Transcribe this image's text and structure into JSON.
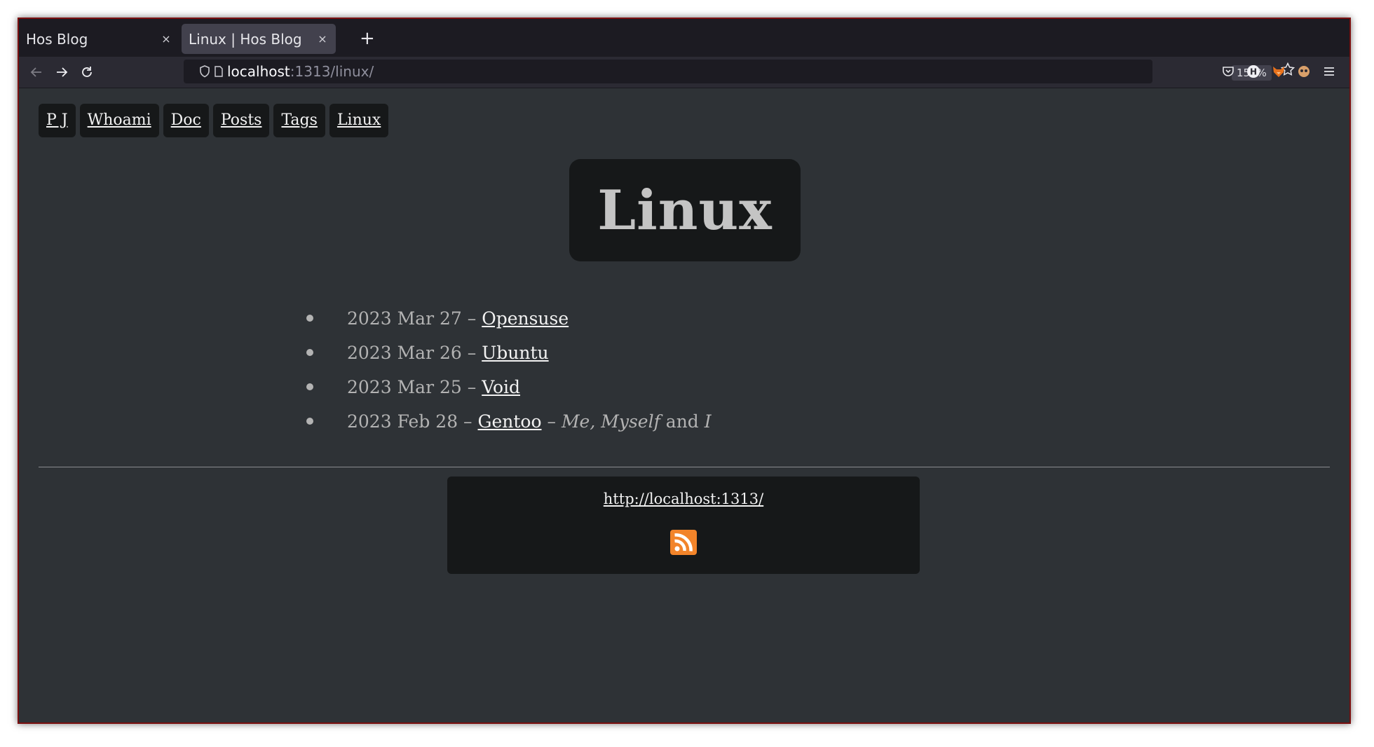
{
  "browser": {
    "tabs": [
      {
        "title": "Hos Blog",
        "active": false
      },
      {
        "title": "Linux | Hos Blog",
        "active": true
      }
    ],
    "new_tab_label": "+",
    "close_label": "×",
    "url": {
      "host": "localhost",
      "rest": ":1313/linux/"
    },
    "zoom": "150%"
  },
  "nav": {
    "items": [
      "P J",
      "Whoami",
      "Doc",
      "Posts",
      "Tags",
      "Linux"
    ]
  },
  "page": {
    "title": "Linux",
    "posts": [
      {
        "date": "2023 Mar 27",
        "sep": " – ",
        "title": "Opensuse"
      },
      {
        "date": "2023 Mar 26",
        "sep": " – ",
        "title": "Ubuntu"
      },
      {
        "date": "2023 Mar 25",
        "sep": " – ",
        "title": "Void"
      },
      {
        "date": "2023 Feb 28",
        "sep": " – ",
        "title": "Gentoo",
        "suffix_sep": " – ",
        "suffix_1": "Me",
        "suffix_2": ", ",
        "suffix_3": "Myself",
        "suffix_4": " and ",
        "suffix_5": "I"
      }
    ]
  },
  "footer": {
    "link": "http://localhost:1313/"
  },
  "colors": {
    "page_bg": "#2e3236",
    "box_bg": "#161819",
    "rss": "#f2842a",
    "window_border": "#7a0f0f"
  },
  "icons": [
    "back-arrow-icon",
    "forward-arrow-icon",
    "reload-icon",
    "shield-icon",
    "page-icon",
    "star-icon",
    "pocket-icon",
    "extension-h-icon",
    "fox-extension-icon",
    "mask-extension-icon",
    "hamburger-menu-icon",
    "rss-icon"
  ]
}
